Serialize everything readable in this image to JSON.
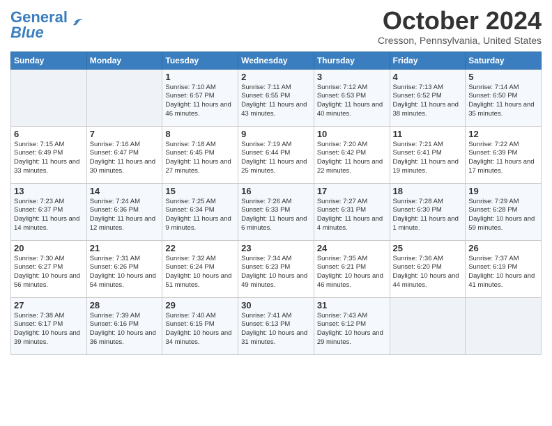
{
  "header": {
    "logo_line1": "General",
    "logo_line2": "Blue",
    "month": "October 2024",
    "location": "Cresson, Pennsylvania, United States"
  },
  "days_of_week": [
    "Sunday",
    "Monday",
    "Tuesday",
    "Wednesday",
    "Thursday",
    "Friday",
    "Saturday"
  ],
  "weeks": [
    [
      {
        "day": "",
        "info": ""
      },
      {
        "day": "",
        "info": ""
      },
      {
        "day": "1",
        "info": "Sunrise: 7:10 AM\nSunset: 6:57 PM\nDaylight: 11 hours and 46 minutes."
      },
      {
        "day": "2",
        "info": "Sunrise: 7:11 AM\nSunset: 6:55 PM\nDaylight: 11 hours and 43 minutes."
      },
      {
        "day": "3",
        "info": "Sunrise: 7:12 AM\nSunset: 6:53 PM\nDaylight: 11 hours and 40 minutes."
      },
      {
        "day": "4",
        "info": "Sunrise: 7:13 AM\nSunset: 6:52 PM\nDaylight: 11 hours and 38 minutes."
      },
      {
        "day": "5",
        "info": "Sunrise: 7:14 AM\nSunset: 6:50 PM\nDaylight: 11 hours and 35 minutes."
      }
    ],
    [
      {
        "day": "6",
        "info": "Sunrise: 7:15 AM\nSunset: 6:49 PM\nDaylight: 11 hours and 33 minutes."
      },
      {
        "day": "7",
        "info": "Sunrise: 7:16 AM\nSunset: 6:47 PM\nDaylight: 11 hours and 30 minutes."
      },
      {
        "day": "8",
        "info": "Sunrise: 7:18 AM\nSunset: 6:45 PM\nDaylight: 11 hours and 27 minutes."
      },
      {
        "day": "9",
        "info": "Sunrise: 7:19 AM\nSunset: 6:44 PM\nDaylight: 11 hours and 25 minutes."
      },
      {
        "day": "10",
        "info": "Sunrise: 7:20 AM\nSunset: 6:42 PM\nDaylight: 11 hours and 22 minutes."
      },
      {
        "day": "11",
        "info": "Sunrise: 7:21 AM\nSunset: 6:41 PM\nDaylight: 11 hours and 19 minutes."
      },
      {
        "day": "12",
        "info": "Sunrise: 7:22 AM\nSunset: 6:39 PM\nDaylight: 11 hours and 17 minutes."
      }
    ],
    [
      {
        "day": "13",
        "info": "Sunrise: 7:23 AM\nSunset: 6:37 PM\nDaylight: 11 hours and 14 minutes."
      },
      {
        "day": "14",
        "info": "Sunrise: 7:24 AM\nSunset: 6:36 PM\nDaylight: 11 hours and 12 minutes."
      },
      {
        "day": "15",
        "info": "Sunrise: 7:25 AM\nSunset: 6:34 PM\nDaylight: 11 hours and 9 minutes."
      },
      {
        "day": "16",
        "info": "Sunrise: 7:26 AM\nSunset: 6:33 PM\nDaylight: 11 hours and 6 minutes."
      },
      {
        "day": "17",
        "info": "Sunrise: 7:27 AM\nSunset: 6:31 PM\nDaylight: 11 hours and 4 minutes."
      },
      {
        "day": "18",
        "info": "Sunrise: 7:28 AM\nSunset: 6:30 PM\nDaylight: 11 hours and 1 minute."
      },
      {
        "day": "19",
        "info": "Sunrise: 7:29 AM\nSunset: 6:28 PM\nDaylight: 10 hours and 59 minutes."
      }
    ],
    [
      {
        "day": "20",
        "info": "Sunrise: 7:30 AM\nSunset: 6:27 PM\nDaylight: 10 hours and 56 minutes."
      },
      {
        "day": "21",
        "info": "Sunrise: 7:31 AM\nSunset: 6:26 PM\nDaylight: 10 hours and 54 minutes."
      },
      {
        "day": "22",
        "info": "Sunrise: 7:32 AM\nSunset: 6:24 PM\nDaylight: 10 hours and 51 minutes."
      },
      {
        "day": "23",
        "info": "Sunrise: 7:34 AM\nSunset: 6:23 PM\nDaylight: 10 hours and 49 minutes."
      },
      {
        "day": "24",
        "info": "Sunrise: 7:35 AM\nSunset: 6:21 PM\nDaylight: 10 hours and 46 minutes."
      },
      {
        "day": "25",
        "info": "Sunrise: 7:36 AM\nSunset: 6:20 PM\nDaylight: 10 hours and 44 minutes."
      },
      {
        "day": "26",
        "info": "Sunrise: 7:37 AM\nSunset: 6:19 PM\nDaylight: 10 hours and 41 minutes."
      }
    ],
    [
      {
        "day": "27",
        "info": "Sunrise: 7:38 AM\nSunset: 6:17 PM\nDaylight: 10 hours and 39 minutes."
      },
      {
        "day": "28",
        "info": "Sunrise: 7:39 AM\nSunset: 6:16 PM\nDaylight: 10 hours and 36 minutes."
      },
      {
        "day": "29",
        "info": "Sunrise: 7:40 AM\nSunset: 6:15 PM\nDaylight: 10 hours and 34 minutes."
      },
      {
        "day": "30",
        "info": "Sunrise: 7:41 AM\nSunset: 6:13 PM\nDaylight: 10 hours and 31 minutes."
      },
      {
        "day": "31",
        "info": "Sunrise: 7:43 AM\nSunset: 6:12 PM\nDaylight: 10 hours and 29 minutes."
      },
      {
        "day": "",
        "info": ""
      },
      {
        "day": "",
        "info": ""
      }
    ]
  ]
}
